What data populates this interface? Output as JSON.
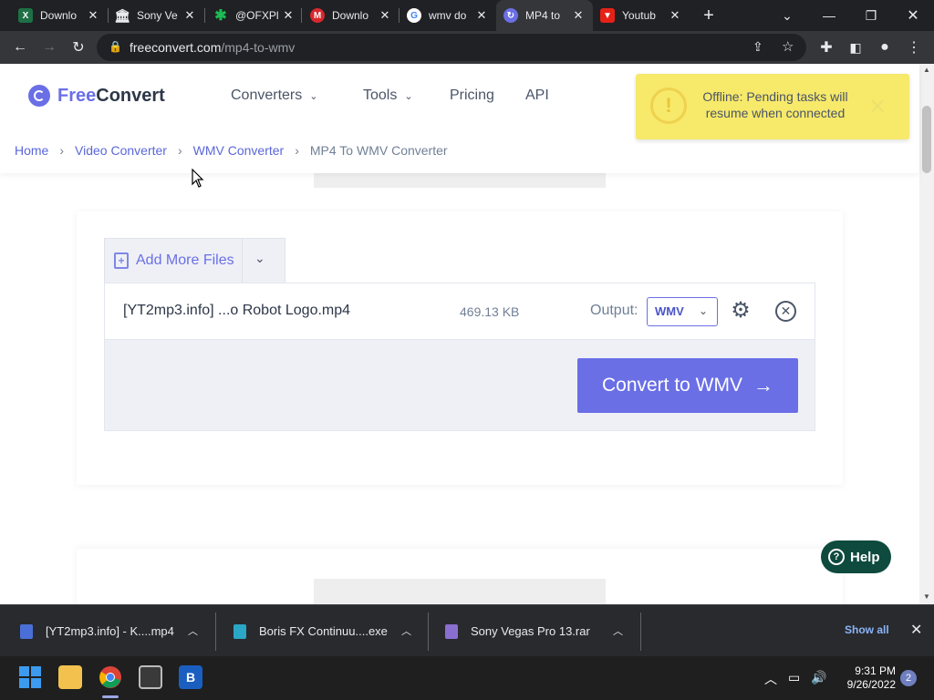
{
  "tabs": [
    {
      "title": "Downlo",
      "icon": "excel-icon",
      "color": "#1e7145"
    },
    {
      "title": "Sony Ve",
      "icon": "building-icon",
      "color": "#5f6368"
    },
    {
      "title": "@OFXPl",
      "icon": "asterisk-icon",
      "color": "#1db954"
    },
    {
      "title": "Downlo",
      "icon": "mega-icon",
      "color": "#d9272e"
    },
    {
      "title": "wmv do",
      "icon": "google-icon",
      "color": "#ffffff"
    },
    {
      "title": "MP4 to",
      "icon": "freeconvert-icon",
      "color": "#6a6fe6"
    },
    {
      "title": "Youtub",
      "icon": "youtube-download-icon",
      "color": "#e62117"
    }
  ],
  "browser": {
    "url_host": "freeconvert.com",
    "url_path": "/mp4-to-wmv"
  },
  "site": {
    "logo_free": "Free",
    "logo_convert": "Convert",
    "nav": [
      "Converters",
      "Tools",
      "Pricing",
      "API"
    ],
    "breadcrumb": [
      "Home",
      "Video Converter",
      "WMV Converter",
      "MP4 To WMV Converter"
    ]
  },
  "toast": {
    "message": "Offline: Pending tasks will resume when connected"
  },
  "converter": {
    "add_files_label": "Add More Files",
    "file_name": "[YT2mp3.info] ...o Robot Logo.mp4",
    "file_size": "469.13 KB",
    "output_label": "Output:",
    "output_format": "WMV",
    "convert_label": "Convert to WMV"
  },
  "help": {
    "label": "Help"
  },
  "downloads": [
    {
      "name": "[YT2mp3.info] - K....mp4",
      "icon": "video-file-icon",
      "color": "#4a6fd8"
    },
    {
      "name": "Boris FX Continuu....exe",
      "icon": "installer-icon",
      "color": "#2aa6c6"
    },
    {
      "name": "Sony Vegas Pro 13.rar",
      "icon": "archive-icon",
      "color": "#8a6fd0"
    }
  ],
  "shelf": {
    "show_all": "Show all"
  },
  "taskbar": {
    "time": "9:31 PM",
    "date": "9/26/2022",
    "notifications": "2"
  }
}
